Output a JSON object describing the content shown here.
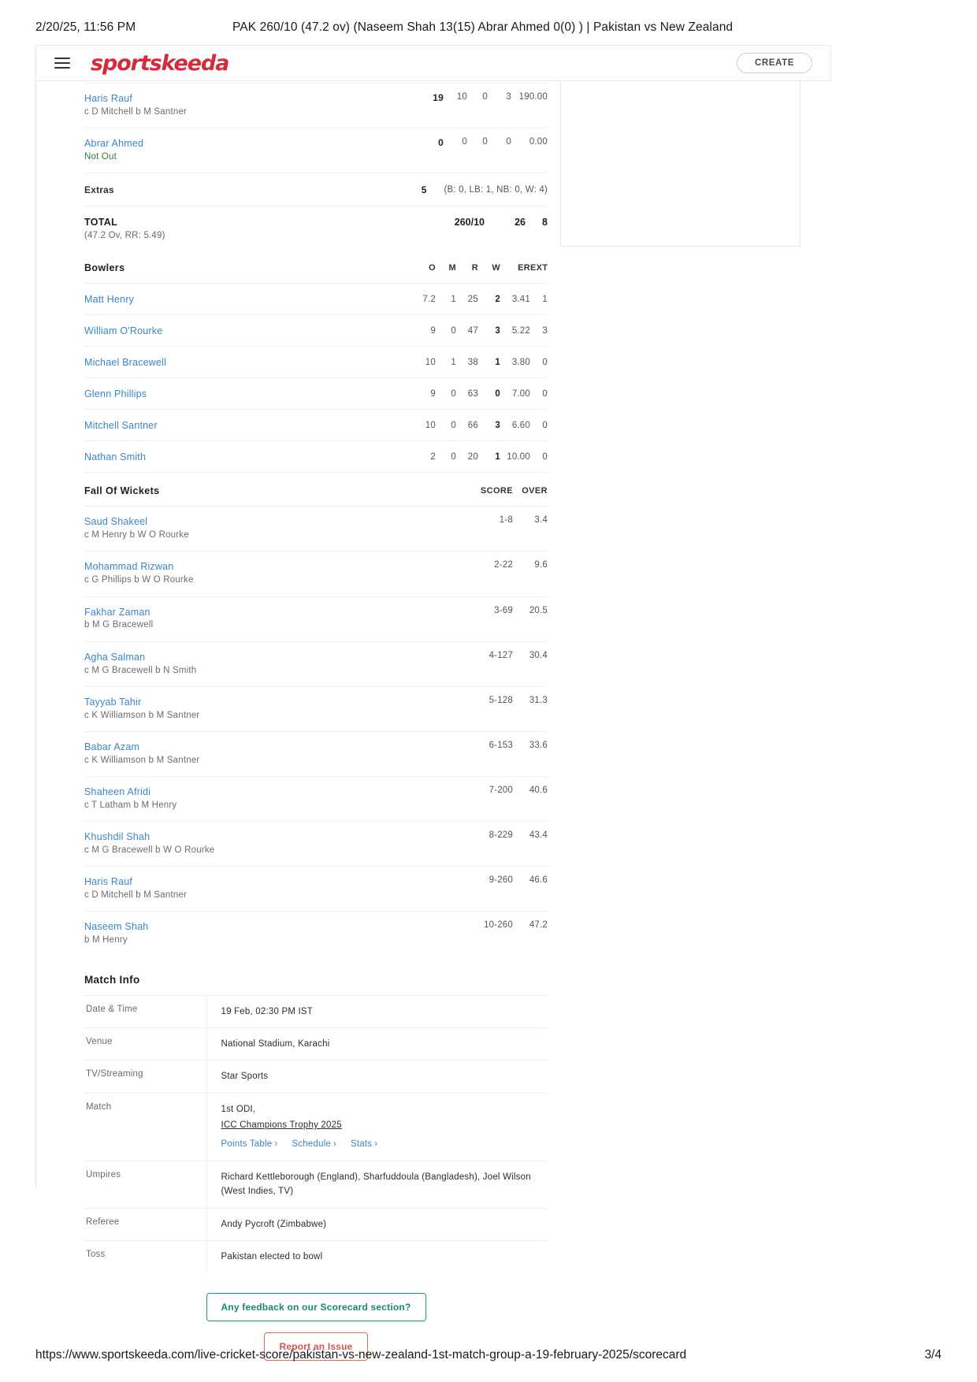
{
  "print": {
    "date": "2/20/25, 11:56 PM",
    "title": "PAK 260/10 (47.2 ov) (Naseem Shah 13(15) Abrar Ahmed 0(0) ) | Pakistan vs New Zealand",
    "url": "https://www.sportskeeda.com/live-cricket-score/pakistan-vs-new-zealand-1st-match-group-a-19-february-2025/scorecard",
    "page": "3/4"
  },
  "header": {
    "brand": "sportskeeda",
    "create_label": "CREATE",
    "menu_icon": "hamburger-icon"
  },
  "batting": {
    "clipped_row_text": "b M Henry",
    "rows": [
      {
        "name": "Haris Rauf",
        "how_out": "c D Mitchell b M Santner",
        "not_out": false,
        "r": "19",
        "b": "10",
        "fours": "0",
        "sixes": "3",
        "sr": "190.00"
      },
      {
        "name": "Abrar Ahmed",
        "how_out": "Not Out",
        "not_out": true,
        "r": "0",
        "b": "0",
        "fours": "0",
        "sixes": "0",
        "sr": "0.00"
      }
    ],
    "extras": {
      "label": "Extras",
      "value": "5",
      "detail": "(B: 0, LB: 1, NB: 0, W: 4)"
    },
    "total": {
      "label": "TOTAL",
      "sub": "(47.2 Ov, RR: 5.49)",
      "score": "260/10",
      "fours": "26",
      "sixes": "8"
    }
  },
  "bowling": {
    "title": "Bowlers",
    "columns": [
      "O",
      "M",
      "R",
      "W",
      "ER",
      "EXT"
    ],
    "rows": [
      {
        "name": "Matt Henry",
        "o": "7.2",
        "m": "1",
        "r": "25",
        "w": "2",
        "er": "3.41",
        "ext": "1"
      },
      {
        "name": "William O'Rourke",
        "o": "9",
        "m": "0",
        "r": "47",
        "w": "3",
        "er": "5.22",
        "ext": "3"
      },
      {
        "name": "Michael Bracewell",
        "o": "10",
        "m": "1",
        "r": "38",
        "w": "1",
        "er": "3.80",
        "ext": "0"
      },
      {
        "name": "Glenn Phillips",
        "o": "9",
        "m": "0",
        "r": "63",
        "w": "0",
        "er": "7.00",
        "ext": "0"
      },
      {
        "name": "Mitchell Santner",
        "o": "10",
        "m": "0",
        "r": "66",
        "w": "3",
        "er": "6.60",
        "ext": "0"
      },
      {
        "name": "Nathan Smith",
        "o": "2",
        "m": "0",
        "r": "20",
        "w": "1",
        "er": "10.00",
        "ext": "0"
      }
    ]
  },
  "fall_of_wickets": {
    "title": "Fall Of Wickets",
    "col_score": "SCORE",
    "col_over": "OVER",
    "rows": [
      {
        "name": "Saud Shakeel",
        "how_out": "c M Henry b W O Rourke",
        "score": "1-8",
        "over": "3.4"
      },
      {
        "name": "Mohammad Rizwan",
        "how_out": "c G Phillips b W O Rourke",
        "score": "2-22",
        "over": "9.6"
      },
      {
        "name": "Fakhar Zaman",
        "how_out": "b M G Bracewell",
        "score": "3-69",
        "over": "20.5"
      },
      {
        "name": "Agha Salman",
        "how_out": "c M G Bracewell b N Smith",
        "score": "4-127",
        "over": "30.4"
      },
      {
        "name": "Tayyab Tahir",
        "how_out": "c K Williamson b M Santner",
        "score": "5-128",
        "over": "31.3"
      },
      {
        "name": "Babar Azam",
        "how_out": "c K Williamson b M Santner",
        "score": "6-153",
        "over": "33.6"
      },
      {
        "name": "Shaheen Afridi",
        "how_out": "c T Latham b M Henry",
        "score": "7-200",
        "over": "40.6"
      },
      {
        "name": "Khushdil Shah",
        "how_out": "c M G Bracewell b W O Rourke",
        "score": "8-229",
        "over": "43.4"
      },
      {
        "name": "Haris Rauf",
        "how_out": "c D Mitchell b M Santner",
        "score": "9-260",
        "over": "46.6"
      },
      {
        "name": "Naseem Shah",
        "how_out": "b M Henry",
        "score": "10-260",
        "over": "47.2"
      }
    ]
  },
  "match_info": {
    "title": "Match Info",
    "date_time_key": "Date & Time",
    "date_time_val": "19 Feb, 02:30 PM IST",
    "venue_key": "Venue",
    "venue_val": "National Stadium, Karachi",
    "tv_key": "TV/Streaming",
    "tv_val": "Star Sports",
    "match_key": "Match",
    "match_val": "1st ODI,",
    "match_series_link": "ICC Champions Trophy 2025",
    "sublinks": [
      "Points Table",
      "Schedule",
      "Stats"
    ],
    "umpires_key": "Umpires",
    "umpires_val": "Richard Kettleborough (England), Sharfuddoula (Bangladesh), Joel Wilson (West Indies, TV)",
    "referee_key": "Referee",
    "referee_val": "Andy Pycroft (Zimbabwe)",
    "toss_key": "Toss",
    "toss_val": "Pakistan elected to bowl"
  },
  "actions": {
    "feedback_label": "Any feedback on our Scorecard section?",
    "report_label": "Report an Issue"
  },
  "colors": {
    "brand": "#d32b3a",
    "link": "#3a87c8",
    "notout": "#2f7d44",
    "feedback": "#188a62",
    "report": "#d9534f"
  }
}
